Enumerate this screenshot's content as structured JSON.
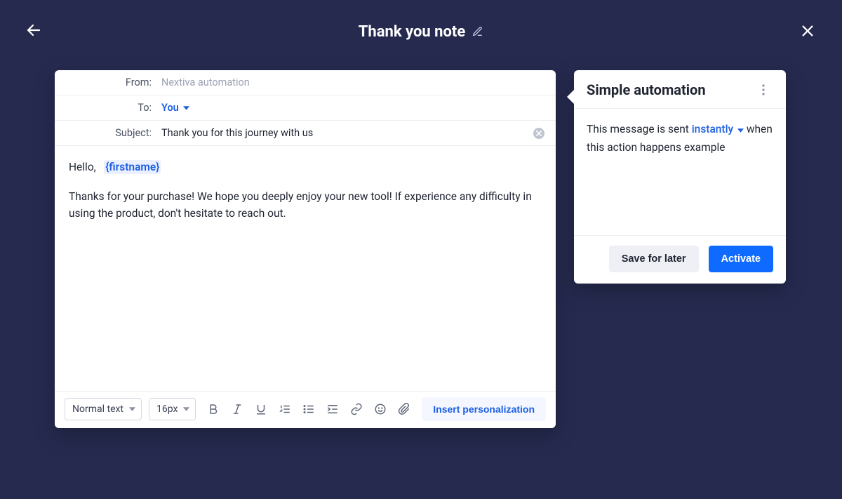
{
  "header": {
    "title": "Thank you note"
  },
  "compose": {
    "labels": {
      "from": "From:",
      "to": "To:",
      "subject": "Subject:"
    },
    "from": "Nextiva automation",
    "to": "You",
    "subject": "Thank you for this journey with us",
    "body_greeting_prefix": "Hello,",
    "body_merge_tag": "{firstname}",
    "body_paragraph": "Thanks for your purchase! We hope you deeply enjoy your new tool! If experience any difficulty in using the product, don't hesitate to reach out."
  },
  "toolbar": {
    "text_style": "Normal text",
    "font_size": "16px",
    "insert_personalization": "Insert personalization"
  },
  "panel": {
    "title": "Simple automation",
    "sentence_before": "This message is sent",
    "timing": "instantly",
    "sentence_after": "when this action happens example",
    "save_label": "Save for later",
    "activate_label": "Activate"
  }
}
